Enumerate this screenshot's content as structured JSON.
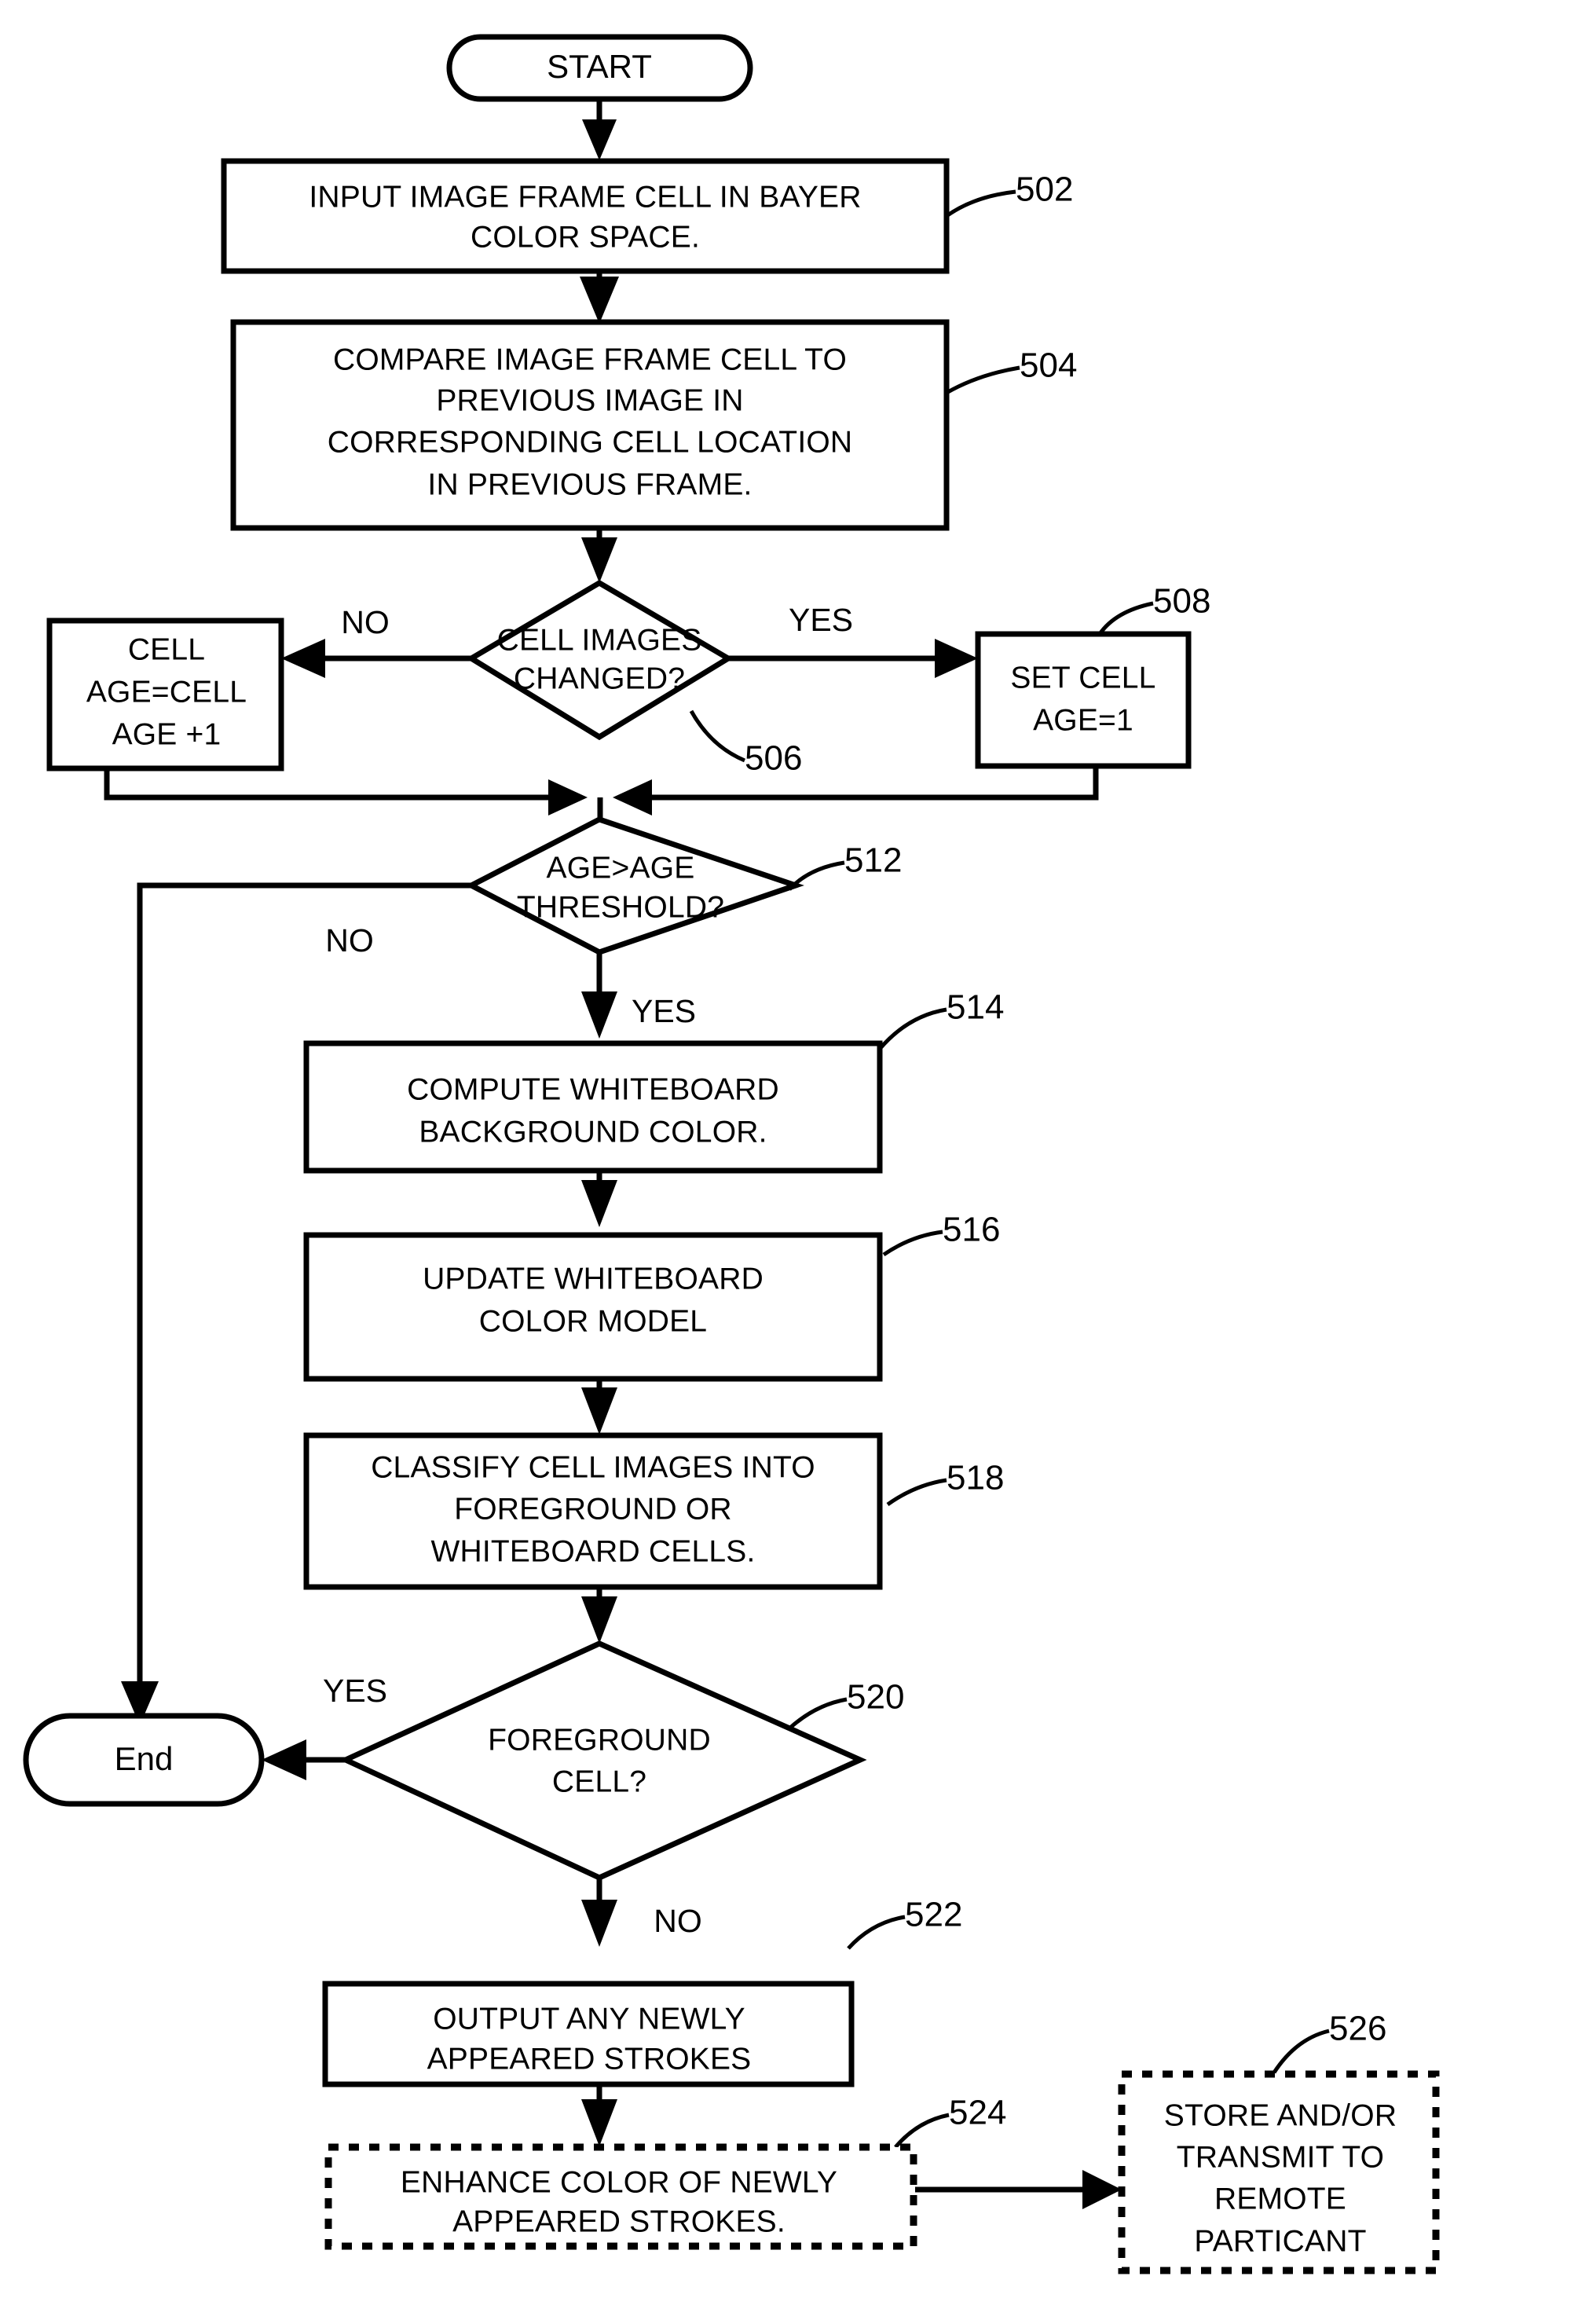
{
  "diagram": {
    "title": "Whiteboard image frame cell processing flowchart",
    "nodes": {
      "start": {
        "label": "START",
        "ref": ""
      },
      "n502": {
        "line1": "INPUT IMAGE FRAME CELL IN BAYER",
        "line2": "COLOR SPACE.",
        "ref": "502"
      },
      "n504": {
        "line1": "COMPARE IMAGE FRAME CELL TO",
        "line2": "PREVIOUS IMAGE IN",
        "line3": "CORRESPONDING CELL LOCATION",
        "line4": "IN PREVIOUS FRAME.",
        "ref": "504"
      },
      "n506": {
        "line1": "CELL IMAGES",
        "line2": "CHANGED?",
        "ref": "506"
      },
      "n507": {
        "line1": "CELL",
        "line2": "AGE=CELL",
        "line3": "AGE +1",
        "ref": ""
      },
      "n508": {
        "line1": "SET CELL",
        "line2": "AGE=1",
        "ref": "508"
      },
      "n512": {
        "line1": "AGE>AGE",
        "line2": "THRESHOLD?",
        "ref": "512"
      },
      "n514": {
        "line1": "COMPUTE WHITEBOARD",
        "line2": "BACKGROUND COLOR.",
        "ref": "514"
      },
      "n516": {
        "line1": "UPDATE WHITEBOARD",
        "line2": "COLOR MODEL",
        "ref": "516"
      },
      "n518": {
        "line1": "CLASSIFY CELL IMAGES INTO",
        "line2": "FOREGROUND OR",
        "line3": "WHITEBOARD CELLS.",
        "ref": "518"
      },
      "n520": {
        "line1": "FOREGROUND",
        "line2": "CELL?",
        "ref": "520"
      },
      "n522": {
        "line1": "OUTPUT ANY NEWLY",
        "line2": "APPEARED STROKES",
        "ref": "522"
      },
      "n524": {
        "line1": "ENHANCE COLOR OF NEWLY",
        "line2": "APPEARED STROKES.",
        "ref": "524"
      },
      "n526": {
        "line1": "STORE AND/OR",
        "line2": "TRANSMIT TO",
        "line3": "REMOTE",
        "line4": "PARTICANT",
        "ref": "526"
      },
      "end": {
        "label": "End",
        "ref": ""
      }
    },
    "branch_labels": {
      "b506_no": "NO",
      "b506_yes": "YES",
      "b512_no": "NO",
      "b512_yes": "YES",
      "b520_yes": "YES",
      "b520_no": "NO"
    },
    "colors": {
      "stroke": "#000000",
      "fill": "#ffffff",
      "background": "#ffffff"
    }
  }
}
